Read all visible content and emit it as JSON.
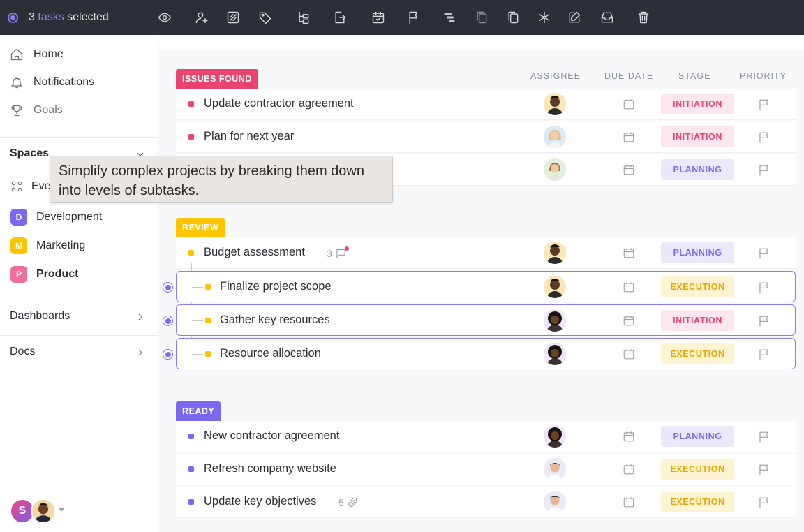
{
  "topbar": {
    "selection_count": "3",
    "selection_word": "tasks",
    "selection_suffix": "selected",
    "actions": [
      "eye-icon",
      "assign-user-icon",
      "tag-grid-icon",
      "tag-icon",
      "subtasks-icon",
      "move-icon",
      "due-date-icon",
      "flag-icon",
      "dependencies-icon",
      "copy-icon",
      "duplicate-icon",
      "custom-fields-icon",
      "edit-icon",
      "archive-icon",
      "trash-icon"
    ]
  },
  "sidebar": {
    "nav": [
      {
        "label": "Home",
        "icon": "home-icon"
      },
      {
        "label": "Notifications",
        "icon": "bell-icon"
      },
      {
        "label": "Goals",
        "icon": "trophy-icon"
      }
    ],
    "spaces_title": "Spaces",
    "everything_label": "Eve",
    "spaces": [
      {
        "letter": "D",
        "label": "Development",
        "color": "#7b68ee"
      },
      {
        "letter": "M",
        "label": "Marketing",
        "color": "#ffc400"
      },
      {
        "letter": "P",
        "label": "Product",
        "color": "#f06e9c"
      }
    ],
    "dashboards": "Dashboards",
    "docs": "Docs",
    "user_initial": "S"
  },
  "tooltip": {
    "text": "Simplify complex projects by breaking them down into levels of subtasks."
  },
  "columns": {
    "assignee": "ASSIGNEE",
    "due_date": "DUE DATE",
    "stage": "STAGE",
    "priority": "PRIORITY"
  },
  "stage_colors": {
    "INITIATION": {
      "bg": "#fde6ee",
      "fg": "#e0457b"
    },
    "PLANNING": {
      "bg": "#ebe8fb",
      "fg": "#7c6ce6"
    },
    "EXECUTION": {
      "bg": "#fff4d1",
      "fg": "#e6a800"
    }
  },
  "groups": [
    {
      "tag": "ISSUES FOUND",
      "color": "#e9436f",
      "tasks": [
        {
          "name": "Update contractor agreement",
          "stage": "INITIATION"
        },
        {
          "name": "Plan for next year",
          "stage": "INITIATION"
        },
        {
          "name": "",
          "stage": "PLANNING"
        }
      ]
    },
    {
      "tag": "REVIEW",
      "color": "#ffc400",
      "tasks": [
        {
          "name": "Budget assessment",
          "stage": "PLANNING",
          "comments": "3"
        },
        {
          "name": "Finalize project scope",
          "stage": "EXECUTION",
          "subtask": true,
          "selected": true
        },
        {
          "name": "Gather key resources",
          "stage": "INITIATION",
          "subtask": true,
          "selected": true
        },
        {
          "name": "Resource allocation",
          "stage": "EXECUTION",
          "subtask": true,
          "selected": true
        }
      ]
    },
    {
      "tag": "READY",
      "color": "#7b68ee",
      "tasks": [
        {
          "name": "New contractor agreement",
          "stage": "PLANNING"
        },
        {
          "name": "Refresh company website",
          "stage": "EXECUTION"
        },
        {
          "name": "Update key objectives",
          "stage": "EXECUTION",
          "attachments": "5"
        }
      ]
    }
  ]
}
